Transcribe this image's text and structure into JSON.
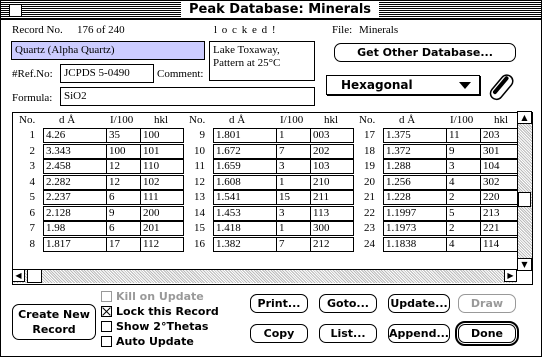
{
  "window": {
    "title": "Peak Database: Minerals"
  },
  "header": {
    "record_label": "Record No.",
    "record_value": "176 of 240",
    "locked_text": "l o c k e d !",
    "file_label": "File:",
    "file_value": "Minerals"
  },
  "fields": {
    "name": "Quartz (Alpha Quartz)",
    "refno_label": "#Ref.No:",
    "refno": "JCPDS 5-0490",
    "comment_label": "Comment:",
    "comment": "Lake Toxaway, Pattern at 25°C",
    "formula_label": "Formula:",
    "formula": "SiO2"
  },
  "controls": {
    "get_other_db": "Get Other Database...",
    "crystal_system": "Hexagonal"
  },
  "table": {
    "columns": [
      "No.",
      "d Å",
      "I/100",
      "hkl"
    ],
    "rows": [
      [
        "1",
        "4.26",
        "35",
        "100"
      ],
      [
        "2",
        "3.343",
        "100",
        "101"
      ],
      [
        "3",
        "2.458",
        "12",
        "110"
      ],
      [
        "4",
        "2.282",
        "12",
        "102"
      ],
      [
        "5",
        "2.237",
        "6",
        "111"
      ],
      [
        "6",
        "2.128",
        "9",
        "200"
      ],
      [
        "7",
        "1.98",
        "6",
        "201"
      ],
      [
        "8",
        "1.817",
        "17",
        "112"
      ],
      [
        "9",
        "1.801",
        "1",
        "003"
      ],
      [
        "10",
        "1.672",
        "7",
        "202"
      ],
      [
        "11",
        "1.659",
        "3",
        "103"
      ],
      [
        "12",
        "1.608",
        "1",
        "210"
      ],
      [
        "13",
        "1.541",
        "15",
        "211"
      ],
      [
        "14",
        "1.453",
        "3",
        "113"
      ],
      [
        "15",
        "1.418",
        "1",
        "300"
      ],
      [
        "16",
        "1.382",
        "7",
        "212"
      ],
      [
        "17",
        "1.375",
        "11",
        "203"
      ],
      [
        "18",
        "1.372",
        "9",
        "301"
      ],
      [
        "19",
        "1.288",
        "3",
        "104"
      ],
      [
        "20",
        "1.256",
        "4",
        "302"
      ],
      [
        "21",
        "1.228",
        "2",
        "220"
      ],
      [
        "22",
        "1.1997",
        "5",
        "213"
      ],
      [
        "23",
        "1.1973",
        "2",
        "221"
      ],
      [
        "24",
        "1.1838",
        "4",
        "114"
      ]
    ]
  },
  "checkboxes": [
    {
      "label": "Kill on Update",
      "checked": false,
      "enabled": false
    },
    {
      "label": "Lock this Record",
      "checked": true,
      "enabled": true
    },
    {
      "label": "Show 2°Thetas",
      "checked": false,
      "enabled": true
    },
    {
      "label": "Auto Update",
      "checked": false,
      "enabled": true
    }
  ],
  "buttons": {
    "create_line1": "Create New",
    "create_line2": "Record",
    "print": "Print...",
    "goto": "Goto...",
    "update": "Update...",
    "draw": "Draw",
    "copy": "Copy",
    "list": "List...",
    "append": "Append...",
    "done": "Done"
  }
}
